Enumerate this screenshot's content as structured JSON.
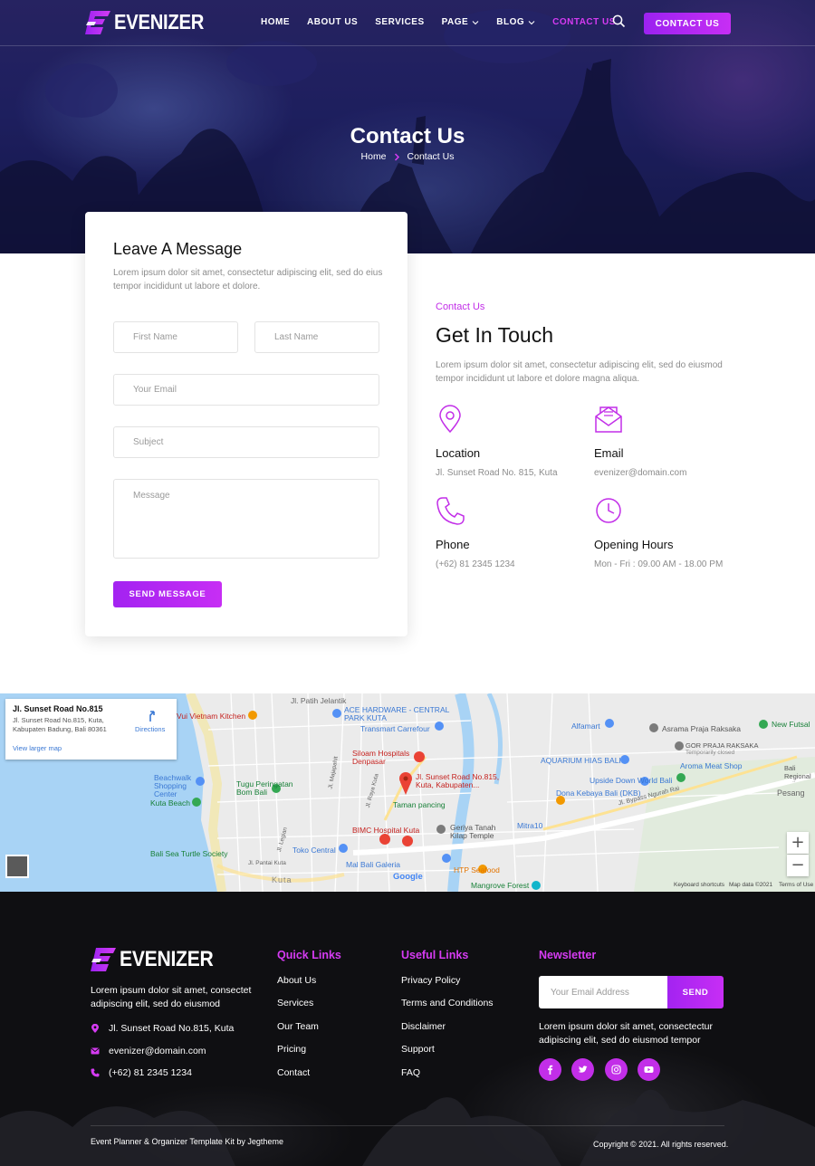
{
  "brand": {
    "name": "EVENIZER",
    "accent": "#c22ee8",
    "accent_gradient": [
      "#9b22f0",
      "#c72ef4"
    ],
    "logo_icon": "e-logo-icon"
  },
  "nav": {
    "items": [
      {
        "label": "HOME",
        "active": false
      },
      {
        "label": "ABOUT US",
        "active": false
      },
      {
        "label": "SERVICES",
        "active": false
      },
      {
        "label": "PAGE",
        "active": false,
        "dropdown": true
      },
      {
        "label": "BLOG",
        "active": false,
        "dropdown": true
      },
      {
        "label": "CONTACT US",
        "active": true
      }
    ],
    "search_icon": "search-icon",
    "cta_label": "CONTACT US"
  },
  "hero": {
    "title": "Contact Us",
    "breadcrumb": {
      "home": "Home",
      "current": "Contact Us"
    }
  },
  "form": {
    "title": "Leave A Message",
    "description": "Lorem ipsum dolor sit amet, consectetur adipiscing elit, sed do eius tempor incididunt ut labore et dolore.",
    "first_name_placeholder": "First Name",
    "last_name_placeholder": "Last Name",
    "email_placeholder": "Your Email",
    "subject_placeholder": "Subject",
    "message_placeholder": "Message",
    "submit_label": "SEND MESSAGE"
  },
  "contact": {
    "kicker": "Contact Us",
    "title": "Get In Touch",
    "description": "Lorem ipsum dolor sit amet, consectetur adipiscing elit, sed do eiusmod tempor incididunt ut labore et dolore magna aliqua.",
    "items": [
      {
        "icon": "location-pin-icon",
        "label": "Location",
        "value": "Jl. Sunset Road No. 815, Kuta"
      },
      {
        "icon": "envelope-icon",
        "label": "Email",
        "value": "evenizer@domain.com"
      },
      {
        "icon": "phone-icon",
        "label": "Phone",
        "value": "(+62) 81 2345 1234"
      },
      {
        "icon": "clock-icon",
        "label": "Opening Hours",
        "value": "Mon - Fri : 09.00 AM - 18.00 PM"
      }
    ]
  },
  "map": {
    "info_title": "Jl. Sunset Road No.815",
    "info_address": "Jl. Sunset Road No.815, Kuta, Kabupaten Badung, Bali 80361",
    "directions_label": "Directions",
    "view_larger_label": "View larger map",
    "pin_label": "Jl. Sunset Road No.815, Kuta, Kabupaten...",
    "zoom_in": "+",
    "zoom_out": "−",
    "attribution": [
      "Keyboard shortcuts",
      "Map data ©2021",
      "Terms of Use"
    ],
    "google": "Google",
    "places": [
      "Jl. Patih Jelantik",
      "ACE HARDWARE - CENTRAL PARK KUTA",
      "Transmart Carrefour",
      "Alfamart",
      "Asrama Praja Raksaka",
      "New Futsal",
      "Vui Vietnam Kitchen",
      "GOR PRAJA RAKSAKA",
      "Temporarily closed",
      "Siloam Hospitals Denpasar",
      "AQUARIUM HIAS BALI",
      "Aroma Meat Shop",
      "Beachwalk Shopping Center",
      "Tugu Peringatan Bom Bali",
      "Upside Down World Bali",
      "Dona Kebaya Bali (DKB)",
      "Kuta Beach",
      "Taman pancing",
      "Jl. Bypass Ngurah Rai",
      "Mitra10",
      "BIMC Hospital Kuta",
      "Geriya Tanah Kilap Temple",
      "Bali Sea Turtle Society",
      "Toko Central",
      "Mal Bali Galeria",
      "HTP Seafood",
      "Mangrove Forest",
      "Pesang",
      "Bali Regional Police - BKN - D",
      "Kuta",
      "Jl. Pantai Kuta",
      "Jl. Raya Kuta",
      "Jl. Legian",
      "Jl. Majapahit"
    ]
  },
  "footer": {
    "description": "Lorem ipsum dolor sit amet, consectet adipiscing elit, sed do eiusmod",
    "address": "Jl. Sunset Road No.815, Kuta",
    "email": "evenizer@domain.com",
    "phone": "(+62) 81 2345 1234",
    "quick_links_title": "Quick Links",
    "quick_links": [
      "About Us",
      "Services",
      "Our Team",
      "Pricing",
      "Contact"
    ],
    "useful_links_title": "Useful Links",
    "useful_links": [
      "Privacy Policy",
      "Terms and Conditions",
      "Disclaimer",
      "Support",
      "FAQ"
    ],
    "newsletter_title": "Newsletter",
    "newsletter_placeholder": "Your Email Address",
    "newsletter_button": "SEND",
    "newsletter_desc": "Lorem ipsum dolor sit amet, consectectur adipiscing elit, sed do eiusmod tempor",
    "social": [
      "facebook-icon",
      "twitter-icon",
      "instagram-icon",
      "youtube-icon"
    ],
    "credit": "Event Planner & Organizer Template Kit by Jegtheme",
    "copyright": "Copyright © 2021. All rights reserved."
  }
}
